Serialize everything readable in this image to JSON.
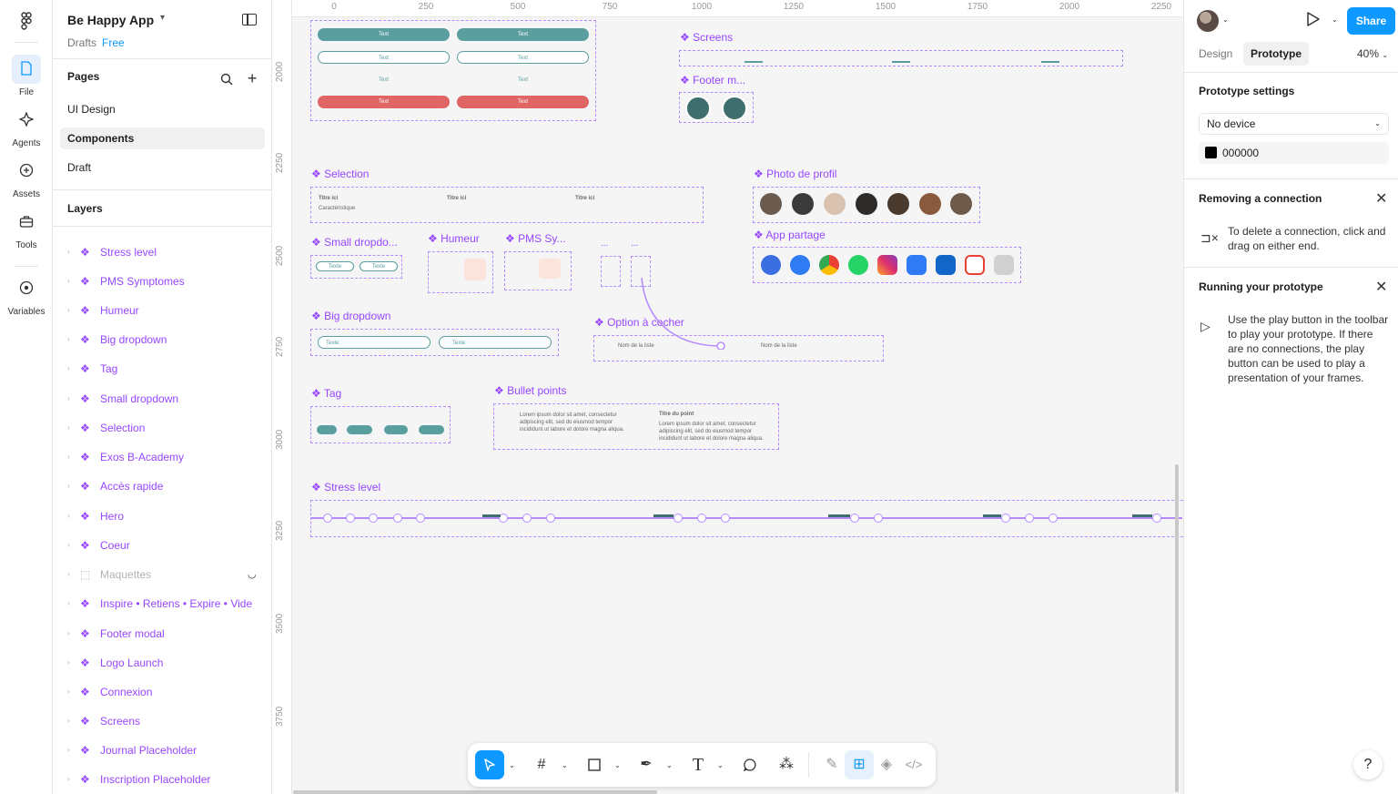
{
  "rail": {
    "items": [
      {
        "label": "File"
      },
      {
        "label": "Agents"
      },
      {
        "label": "Assets"
      },
      {
        "label": "Tools"
      },
      {
        "label": "Variables"
      }
    ]
  },
  "project": {
    "title": "Be Happy App",
    "location": "Drafts",
    "plan": "Free"
  },
  "pages": {
    "title": "Pages",
    "items": [
      {
        "label": "UI Design"
      },
      {
        "label": "Components"
      },
      {
        "label": "Draft"
      }
    ]
  },
  "layers": {
    "title": "Layers",
    "items": [
      {
        "label": "Stress level"
      },
      {
        "label": "PMS Symptomes"
      },
      {
        "label": "Humeur"
      },
      {
        "label": "Big dropdown"
      },
      {
        "label": "Tag"
      },
      {
        "label": "Small dropdown"
      },
      {
        "label": "Selection"
      },
      {
        "label": "Exos B-Academy"
      },
      {
        "label": "Accès rapide"
      },
      {
        "label": "Hero"
      },
      {
        "label": "Coeur"
      },
      {
        "label": "Maquettes"
      },
      {
        "label": "Inspire • Retiens • Expire • Vide"
      },
      {
        "label": "Footer modal"
      },
      {
        "label": "Logo Launch"
      },
      {
        "label": "Connexion"
      },
      {
        "label": "Screens"
      },
      {
        "label": "Journal Placeholder"
      },
      {
        "label": "Inscription Placeholder"
      }
    ]
  },
  "ruler": {
    "top": [
      "0",
      "250",
      "500",
      "750",
      "1000",
      "1250",
      "1500",
      "1750",
      "2000",
      "2250"
    ],
    "left": [
      "2000",
      "2250",
      "2500",
      "2750",
      "3000",
      "3250",
      "3500",
      "3750"
    ]
  },
  "canvas": {
    "frames": [
      "❖ Screens",
      "❖ Footer m...",
      "❖ Selection",
      "❖ Photo de profil",
      "❖ Small dropdo...",
      "❖ Humeur",
      "❖ PMS Sy...",
      "❖ App partage",
      "❖ Big dropdown",
      "❖ Option à cocher",
      "❖ Tag",
      "❖ Bullet points",
      "❖ Stress level"
    ],
    "button_text": "Text",
    "selection_title": "Titre ici",
    "selection_sub": "Caractéristique",
    "dropdown_text": "Texte",
    "option_text": "Nom de la liste",
    "bullet_text": "Lorem ipsum dolor sit amet, consectetur adipiscing elit, sed do eiusmod tempor incididunt ut labore et dolore magna aliqua.",
    "bullet_title": "Titre du point",
    "ellipsis": "..."
  },
  "toolbar": {
    "tools": [
      "move",
      "frame",
      "shape",
      "pen",
      "text",
      "comment",
      "actions",
      "draw",
      "dev-mode-layout",
      "components",
      "code"
    ]
  },
  "right": {
    "share": "Share",
    "tabs": [
      "Design",
      "Prototype"
    ],
    "zoom": "40%",
    "prototype_settings": "Prototype settings",
    "device": "No device",
    "bg_color": "000000",
    "removing_title": "Removing a connection",
    "removing_text": "To delete a connection, click and drag on either end.",
    "running_title": "Running your prototype",
    "running_text": "Use the play button in the toolbar to play your prototype. If there are no connections, the play button can be used to play a presentation of your frames.",
    "help": "?"
  },
  "colors": {
    "accent": "#0d99ff",
    "component": "#9747ff",
    "teal": "#5b9ea0",
    "red": "#e06565"
  }
}
